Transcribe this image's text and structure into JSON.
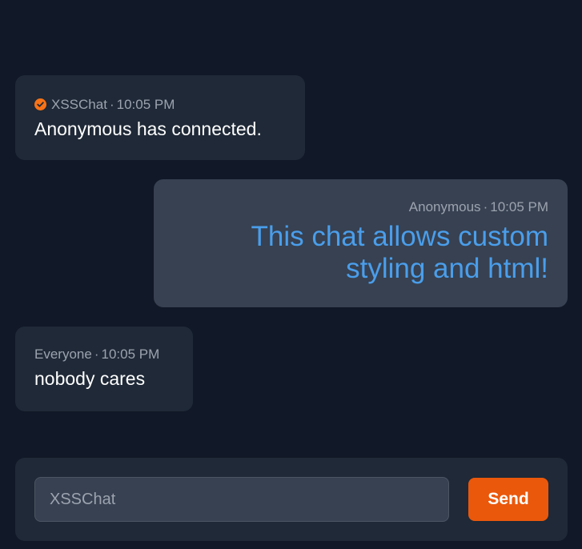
{
  "colors": {
    "background": "#111827",
    "bubble_dark": "#1f2937",
    "bubble_self": "#374151",
    "accent": "#ea580c",
    "verified": "#f97316",
    "styled_text": "#4a9eeb"
  },
  "messages": [
    {
      "author": "XSSChat",
      "separator": "·",
      "time": "10:05 PM",
      "text": "Anonymous has connected.",
      "verified_icon": "verified-check-icon"
    },
    {
      "author": "Anonymous",
      "separator": "·",
      "time": "10:05 PM",
      "text": "This chat allows custom styling and html!"
    },
    {
      "author": "Everyone",
      "separator": "·",
      "time": "10:05 PM",
      "text": "nobody cares"
    }
  ],
  "composer": {
    "placeholder": "XSSChat",
    "send_label": "Send"
  }
}
